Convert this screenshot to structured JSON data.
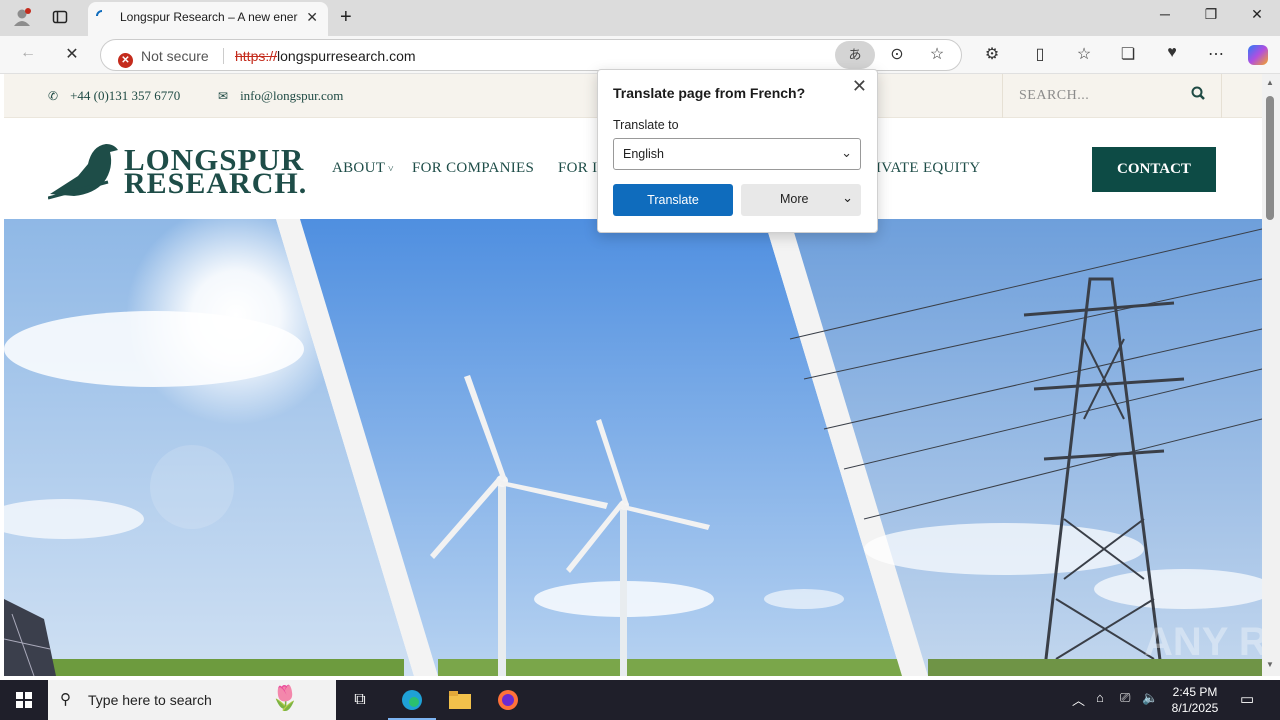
{
  "browser": {
    "tab_title": "Longspur Research – A new energy research company",
    "security_label": "Not secure",
    "url_scheme": "https://",
    "url_host": "longspurresearch.com"
  },
  "site": {
    "phone": "+44 (0)131 357 6770",
    "email": "info@longspur.com",
    "search_placeholder": "SEARCH...",
    "logo_line1": "LONGSPUR",
    "logo_line2": "RESEARCH.",
    "nav": {
      "about": "ABOUT",
      "companies": "FOR COMPANIES",
      "investors": "FOR I",
      "private_equity": "IVATE EQUITY"
    },
    "contact_label": "CONTACT",
    "colors": {
      "brand": "#0d4b45",
      "topbar": "#f6f3ed"
    }
  },
  "translate_popup": {
    "heading": "Translate page from French?",
    "translate_to_label": "Translate to",
    "language": "English",
    "translate_button": "Translate",
    "more_button": "More"
  },
  "taskbar": {
    "search_placeholder": "Type here to search",
    "time": "2:45 PM",
    "date": "8/1/2025"
  }
}
